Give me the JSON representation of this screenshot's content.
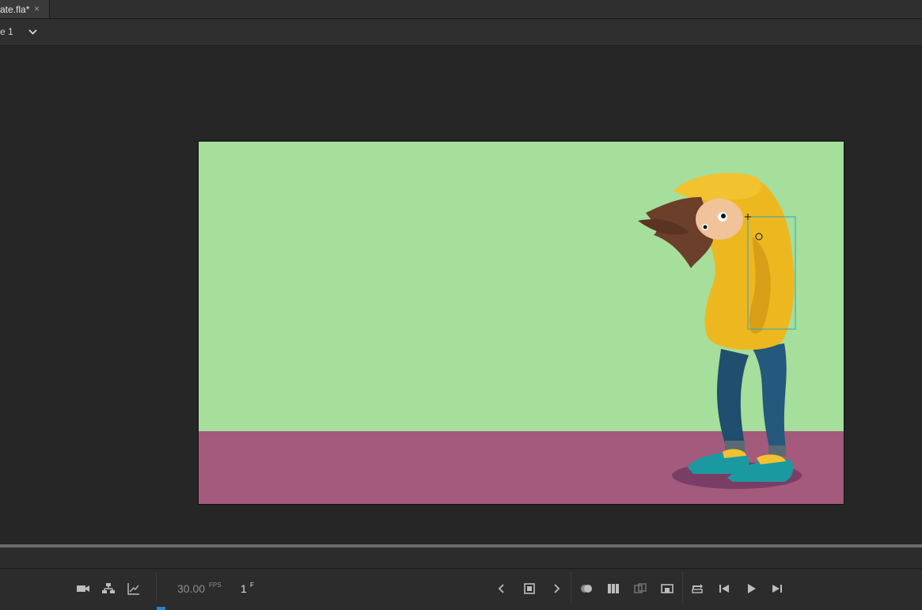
{
  "tabs": [
    {
      "label": "ate.fla*",
      "close": "×"
    }
  ],
  "scene": {
    "label": "e 1",
    "dropdown_icon": "chevron-down-icon"
  },
  "stage": {
    "sky_color": "#a6de9b",
    "ground_color": "#a35a7c",
    "character": "girl-in-yellow-hoodie"
  },
  "timeline": {
    "fps_value": "30.00",
    "fps_unit": "FPS",
    "frame_value": "1",
    "frame_unit": "F",
    "left_icons": [
      "camera-icon",
      "layer-hierarchy-icon",
      "graph-icon"
    ],
    "right_icons": [
      "prev-keyframe-icon",
      "insert-keyframe-icon",
      "next-keyframe-icon",
      "onion-skin-icon",
      "edit-multiple-frames-icon",
      "onion-outline-icon",
      "center-frame-icon",
      "loop-icon",
      "step-back-icon",
      "play-icon",
      "step-forward-icon"
    ]
  }
}
